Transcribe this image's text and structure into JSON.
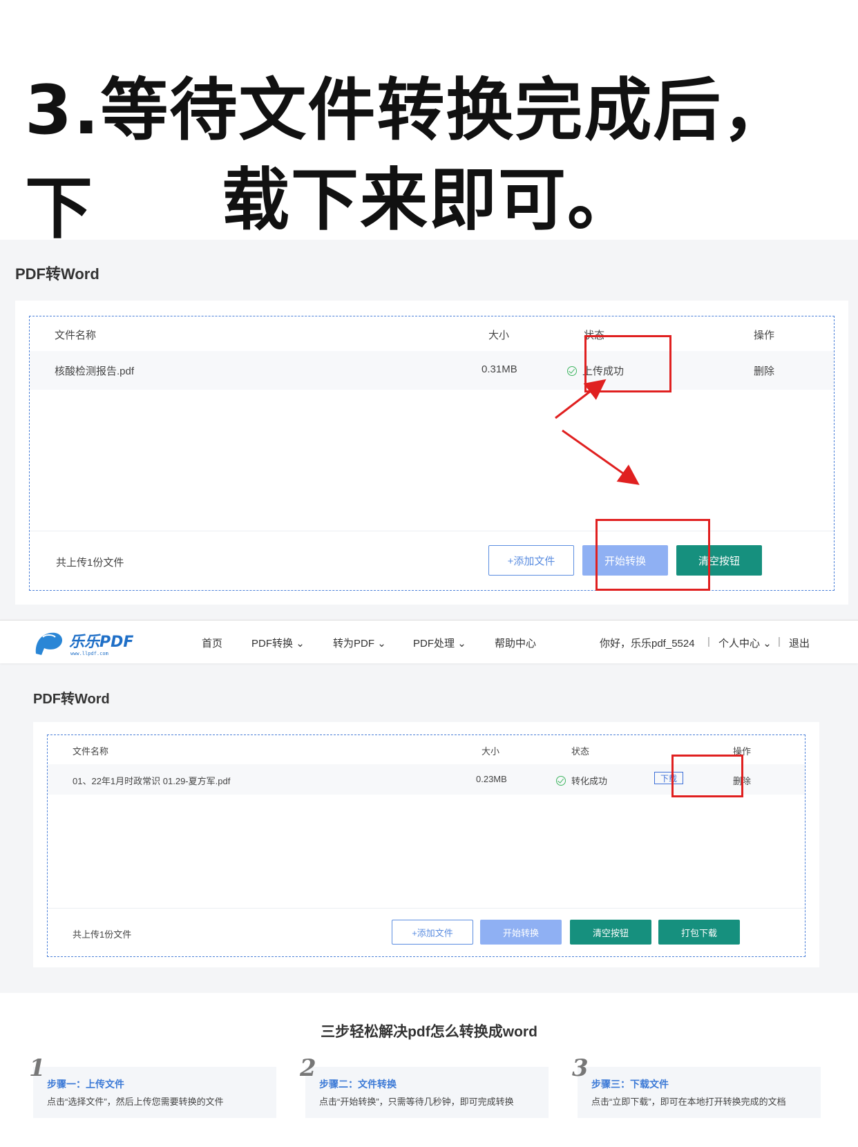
{
  "headline": {
    "line1": "3.等待文件转换完成后，下",
    "line2": "载下来即可。"
  },
  "shot1": {
    "page_title": "PDF转Word",
    "columns": {
      "name": "文件名称",
      "size": "大小",
      "status": "状态",
      "action": "操作"
    },
    "row": {
      "name": "核酸检测报告.pdf",
      "size": "0.31MB",
      "status": "上传成功",
      "action": "删除"
    },
    "footer": {
      "count": "共上传1份文件",
      "add": "+添加文件",
      "start": "开始转换",
      "clear": "清空按钮"
    }
  },
  "shot2": {
    "nav": {
      "logo_text": "乐乐PDF",
      "logo_url": "www.llpdf.com",
      "home": "首页",
      "pdf_convert": "PDF转换",
      "to_pdf": "转为PDF",
      "pdf_process": "PDF处理",
      "help": "帮助中心",
      "greeting": "你好，乐乐pdf_5524",
      "user_center": "个人中心",
      "logout": "退出"
    },
    "page_title": "PDF转Word",
    "columns": {
      "name": "文件名称",
      "size": "大小",
      "status": "状态",
      "action": "操作"
    },
    "row": {
      "name": "01、22年1月时政常识 01.29-夏方军.pdf",
      "size": "0.23MB",
      "status": "转化成功",
      "download": "下载",
      "action": "删除"
    },
    "footer": {
      "count": "共上传1份文件",
      "add": "+添加文件",
      "start": "开始转换",
      "clear": "清空按钮",
      "pack": "打包下载"
    }
  },
  "steps": {
    "title": "三步轻松解决pdf怎么转换成word",
    "items": [
      {
        "num": "1",
        "head": "步骤一：上传文件",
        "desc": "点击“选择文件”，然后上传您需要转换的文件"
      },
      {
        "num": "2",
        "head": "步骤二：文件转换",
        "desc": "点击“开始转换”，只需等待几秒钟，即可完成转换"
      },
      {
        "num": "3",
        "head": "步骤三：下载文件",
        "desc": "点击“立即下载”，即可在本地打开转换完成的文档"
      }
    ]
  },
  "colors": {
    "teal": "#16907e",
    "blue_disabled": "#8fb0f3",
    "link_blue": "#3b79d6",
    "annotation_red": "#e02020"
  }
}
